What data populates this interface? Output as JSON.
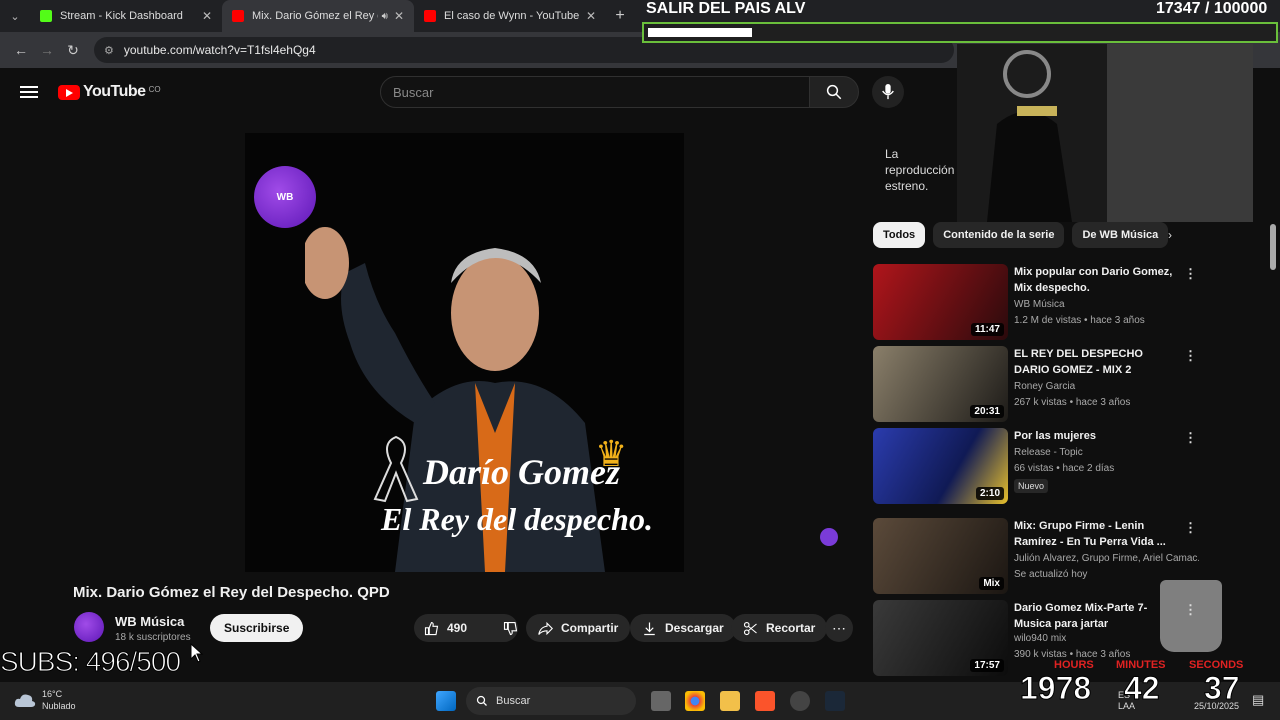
{
  "browser": {
    "tabs": [
      {
        "title": "Stream - Kick Dashboard",
        "favicon_color": "#53fc18",
        "active": false
      },
      {
        "title": "Mix. Dario Gómez el Rey de",
        "favicon_color": "#ff0000",
        "active": true
      },
      {
        "title": "El caso de Wynn - YouTube",
        "favicon_color": "#ff0000",
        "active": false
      }
    ],
    "url": "youtube.com/watch?v=T1fsl4ehQg4"
  },
  "yt": {
    "logo_text": "YouTube",
    "country": "CO",
    "search_placeholder": "Buscar",
    "video": {
      "title": "Mix. Dario Gómez el Rey del Despecho. QPD",
      "thumb_badge": "WB",
      "thumb_title": "Darío Gomez",
      "thumb_subtitle": "El Rey del despecho."
    },
    "channel": {
      "name": "WB Música",
      "subscribers": "18 k suscriptores",
      "subscribe_label": "Suscribirse"
    },
    "actions": {
      "likes": "490",
      "share": "Compartir",
      "download": "Descargar",
      "clip": "Recortar"
    },
    "premiere_text": "La reproducción estreno.",
    "chips": [
      "Todos",
      "Contenido de la serie",
      "De WB Música"
    ],
    "recommendations": [
      {
        "title": "Mix popular con Dario Gomez, Mix despecho.",
        "channel": "WB Música",
        "meta": "1.2 M de vistas • hace 3 años",
        "duration": "11:47",
        "badge": "",
        "color1": "#b0151b",
        "color2": "#2a0a0c"
      },
      {
        "title": "EL REY DEL DESPECHO DARIO GOMEZ - MIX 2",
        "channel": "Roney Garcia",
        "meta": "267 k vistas • hace 3 años",
        "duration": "20:31",
        "badge": "",
        "color1": "#8a7f6a",
        "color2": "#1d1b18"
      },
      {
        "title": "Por las mujeres",
        "channel": "Release - Topic",
        "meta": "66 vistas • hace 2 días",
        "duration": "2:10",
        "badge": "Nuevo",
        "color1": "#2b3cae",
        "color2": "#e8c12c"
      },
      {
        "title": "Mix: Grupo Firme - Lenin Ramírez - En Tu Perra Vida ...",
        "channel": "Julión Álvarez, Grupo Firme, Ariel Camac...",
        "meta": "Se actualizó hoy",
        "duration": "Mix",
        "badge": "",
        "color1": "#5b4a3a",
        "color2": "#1b1612"
      },
      {
        "title": "Dario Gomez Mix-Parte 7- Musica para jartar",
        "channel": "wilo940 mix",
        "meta": "390 k vistas • hace 3 años",
        "duration": "17:57",
        "badge": "",
        "color1": "#3a3a3a",
        "color2": "#0c0c0c"
      }
    ]
  },
  "overlay": {
    "goal_title": "SALIR DEL PAIS ALV",
    "goal_current": "17347",
    "goal_target": "/ 100000",
    "goal_progress": 0.17347,
    "subs_text": "SUBS: 496/500",
    "timer": {
      "hours_label": "HOURS",
      "minutes_label": "MINUTES",
      "seconds_label": "SECONDS",
      "hours": "1978",
      "minutes": "42",
      "seconds": "37"
    }
  },
  "taskbar": {
    "temp": "16°C",
    "weather": "Nublado",
    "search": "Buscar",
    "lang1": "ES",
    "lang2": "LAA",
    "date": "25/10/2025"
  }
}
